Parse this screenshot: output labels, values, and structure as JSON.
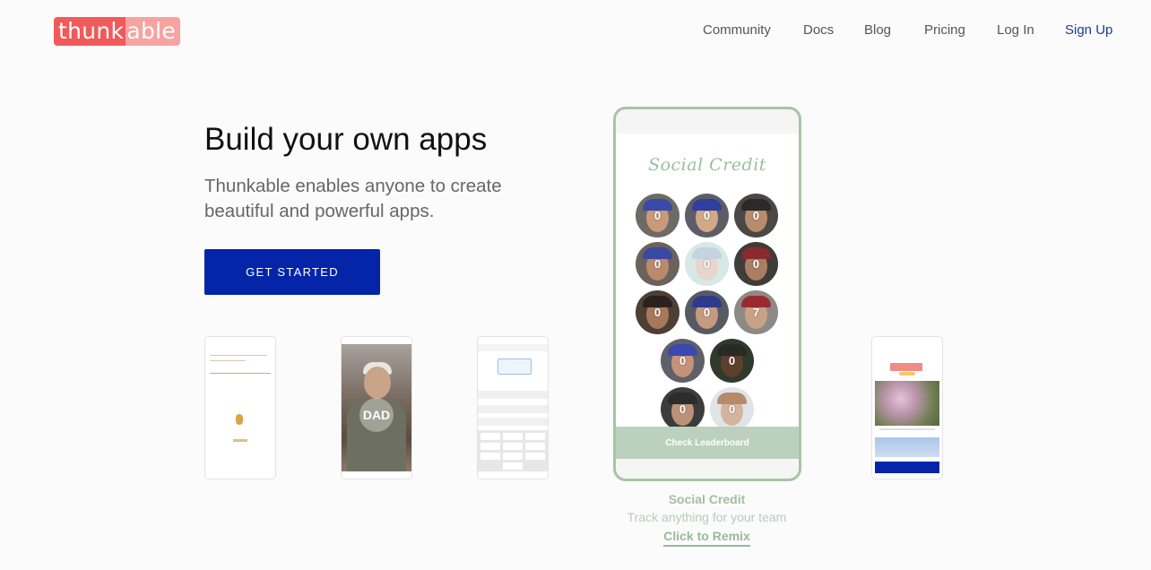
{
  "header": {
    "logo": {
      "part1": "thunk",
      "part2": "able"
    },
    "nav": [
      {
        "label": "Community"
      },
      {
        "label": "Docs"
      },
      {
        "label": "Blog"
      },
      {
        "label": "Pricing"
      },
      {
        "label": "Log In"
      },
      {
        "label": "Sign Up"
      }
    ]
  },
  "hero": {
    "headline": "Build your own apps",
    "subheadline": "Thunkable enables anyone to create beautiful and powerful apps.",
    "cta_label": "GET STARTED"
  },
  "gallery": {
    "thumb_dad_label": "DAD",
    "featured": {
      "app_title": "Social Credit",
      "scores": [
        "0",
        "0",
        "0",
        "0",
        "0",
        "0",
        "0",
        "0",
        "7",
        "0",
        "0",
        "0",
        "0"
      ],
      "button_label": "Check Leaderboard",
      "caption_title": "Social Credit",
      "caption_subtitle": "Track anything for your team",
      "caption_link": "Click to Remix"
    }
  },
  "colors": {
    "brand_red": "#f05a5a",
    "brand_pink": "#f7a3a0",
    "cta_blue": "#0425a8",
    "featured_green": "#a8c4a6",
    "signup_blue": "#1d3b8f"
  }
}
